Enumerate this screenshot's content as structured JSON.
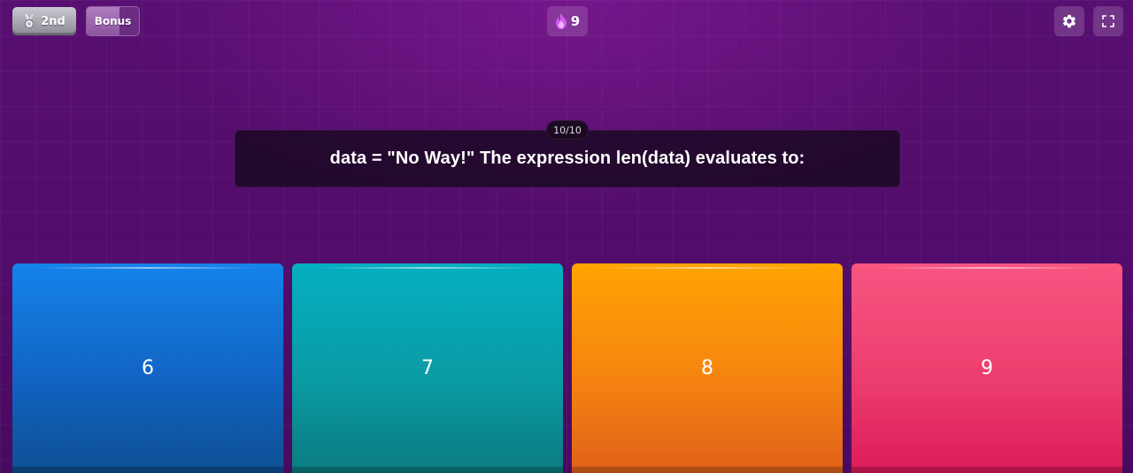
{
  "header": {
    "rank_label": "2nd",
    "rank_icon": "medal-icon",
    "bonus_label": "Bonus",
    "bonus_fill_percent": 62,
    "streak_icon": "flame-icon",
    "streak_count": "9",
    "settings_icon": "gear-icon",
    "fullscreen_icon": "fullscreen-icon"
  },
  "question": {
    "counter": "10/10",
    "text": "data = \"No Way!\" The expression len(data) evaluates to:"
  },
  "answers": [
    {
      "label": "6",
      "color": "#1164c3"
    },
    {
      "label": "7",
      "color": "#0a9ba4"
    },
    {
      "label": "8",
      "color": "#f68410"
    },
    {
      "label": "9",
      "color": "#ec3e6e"
    }
  ],
  "colors": {
    "background": "#520c6a",
    "question_box": "#1a0820"
  }
}
